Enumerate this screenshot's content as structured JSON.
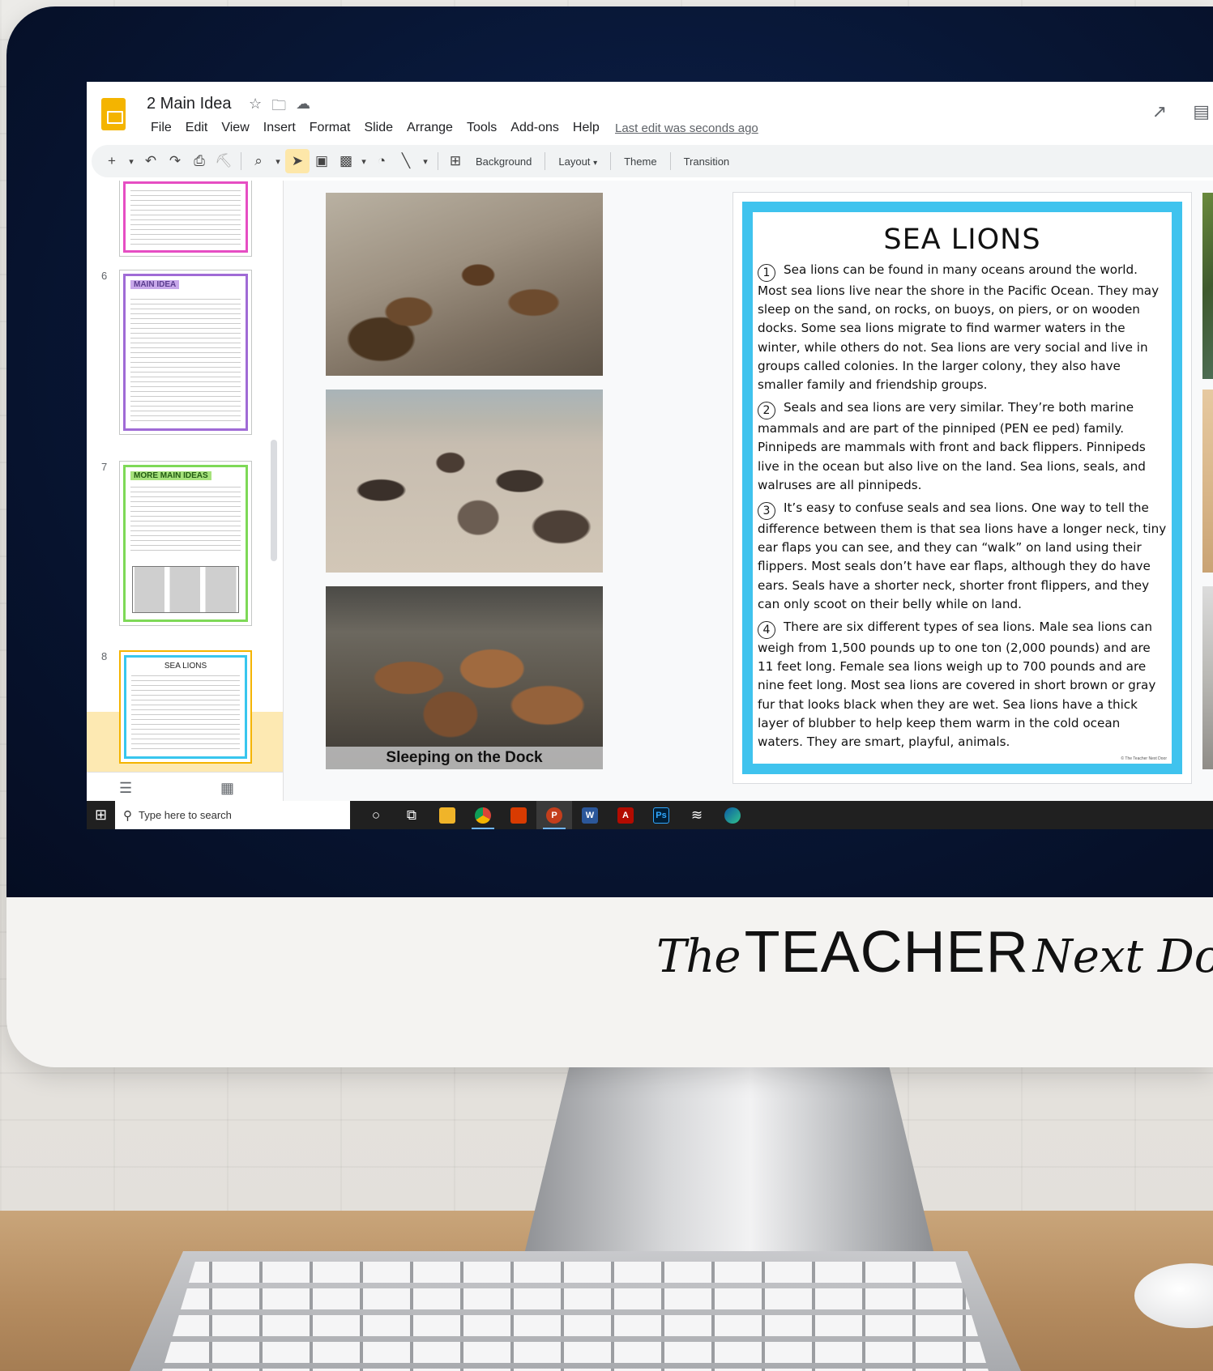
{
  "app": {
    "doc_title": "2 Main Idea",
    "menu": [
      "File",
      "Edit",
      "View",
      "Insert",
      "Format",
      "Slide",
      "Arrange",
      "Tools",
      "Add-ons",
      "Help"
    ],
    "last_edit": "Last edit was seconds ago"
  },
  "toolbar": {
    "background": "Background",
    "layout": "Layout",
    "theme": "Theme",
    "transition": "Transition"
  },
  "filmstrip": {
    "slides": [
      {
        "number": "6",
        "heading": "MAIN IDEA"
      },
      {
        "number": "7",
        "heading": "MORE MAIN IDEAS"
      },
      {
        "number": "8",
        "heading": "SEA LIONS"
      }
    ]
  },
  "slide": {
    "caption": "Sleeping on the Dock",
    "title": "SEA LIONS",
    "paragraphs": [
      {
        "num": "1",
        "text": "Sea lions can be found in many oceans around the world. Most sea lions live near the shore in the Pacific Ocean. They may sleep on the sand, on rocks, on buoys, on piers, or on wooden docks. Some sea lions migrate to find warmer waters in the winter, while others do not. Sea lions are very social and live in groups called colonies. In the larger colony, they also have smaller family and friendship groups."
      },
      {
        "num": "2",
        "text": "Seals and sea lions are very similar. They’re both marine mammals and are part of the pinniped (PEN ee ped) family. Pinnipeds are mammals with front and back flippers. Pinnipeds live in the ocean but also live on the land. Sea lions, seals, and walruses are all pinnipeds."
      },
      {
        "num": "3",
        "text": "It’s easy to confuse seals and sea lions. One way to tell the difference between them is that sea lions have a longer neck, tiny ear flaps you can see, and they can “walk” on land using their flippers. Most seals don’t have ear flaps, although they do have ears. Seals have a shorter neck, shorter front flippers, and they can only scoot on their belly while on land."
      },
      {
        "num": "4",
        "text": "There are six different types of sea lions. Male sea lions can weigh from 1,500 pounds up to one ton (2,000 pounds) and are 11 feet long. Female sea lions weigh up to 700 pounds and are nine feet long. Most sea lions are covered in short brown or gray fur that looks black when they are wet. Sea lions have a thick layer of blubber to help keep them warm in the cold ocean waters. They are smart, playful, animals."
      }
    ],
    "copyright": "© The Teacher Next Door"
  },
  "taskbar": {
    "search_placeholder": "Type here to search"
  },
  "brand": {
    "part1": "The",
    "part2": "TEACHER",
    "part3": "Next Door"
  },
  "colors": {
    "slide_border": "#3fc3ee",
    "logo": "#f4b400",
    "selected_slide": "#fde9b2"
  }
}
